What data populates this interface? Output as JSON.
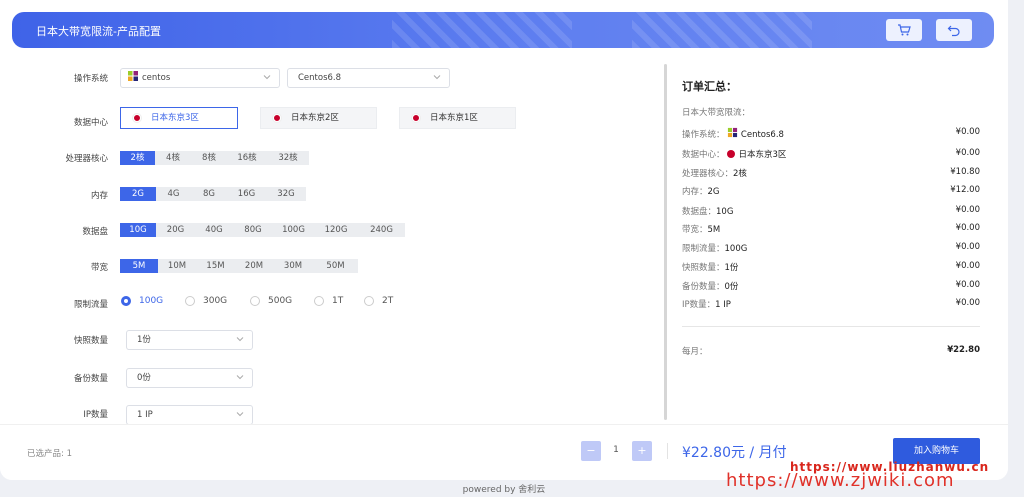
{
  "header": {
    "title": "日本大带宽限流-产品配置"
  },
  "config": {
    "os_label": "操作系统",
    "os_type": "centos",
    "os_version": "Centos6.8",
    "dc_label": "数据中心",
    "datacenters": [
      "日本东京3区",
      "日本东京2区",
      "日本东京1区"
    ],
    "cpu_label": "处理器核心",
    "cpu_options": [
      "2核",
      "4核",
      "8核",
      "16核",
      "32核"
    ],
    "mem_label": "内存",
    "mem_options": [
      "2G",
      "4G",
      "8G",
      "16G",
      "32G"
    ],
    "disk_label": "数据盘",
    "disk_options": [
      "10G",
      "20G",
      "40G",
      "80G",
      "100G",
      "120G",
      "240G"
    ],
    "bw_label": "带宽",
    "bw_options": [
      "5M",
      "10M",
      "15M",
      "20M",
      "30M",
      "50M"
    ],
    "traffic_label": "限制流量",
    "traffic_options": [
      "100G",
      "300G",
      "500G",
      "1T",
      "2T"
    ],
    "snapshot_label": "快照数量",
    "snapshot_value": "1份",
    "backup_label": "备份数量",
    "backup_value": "0份",
    "ip_label": "IP数量",
    "ip_value": "1 IP"
  },
  "summary": {
    "title": "订单汇总：",
    "product": "日本大带宽限流：",
    "rows": [
      {
        "label": "操作系统：",
        "value": "Centos6.8",
        "price": "¥0.00"
      },
      {
        "label": "数据中心：",
        "value": "日本东京3区",
        "price": "¥0.00"
      },
      {
        "label": "处理器核心：",
        "value": "2核",
        "price": "¥10.80"
      },
      {
        "label": "内存：",
        "value": "2G",
        "price": "¥12.00"
      },
      {
        "label": "数据盘：",
        "value": "10G",
        "price": "¥0.00"
      },
      {
        "label": "带宽：",
        "value": "5M",
        "price": "¥0.00"
      },
      {
        "label": "限制流量：",
        "value": "100G",
        "price": "¥0.00"
      },
      {
        "label": "快照数量：",
        "value": "1份",
        "price": "¥0.00"
      },
      {
        "label": "备份数量：",
        "value": "0份",
        "price": "¥0.00"
      },
      {
        "label": "IP数量：",
        "value": "1 IP",
        "price": "¥0.00"
      }
    ],
    "monthly_label": "每月：",
    "monthly_total": "¥22.80"
  },
  "footer": {
    "selected": "已选产品: 1",
    "minus": "−",
    "quantity": "1",
    "plus": "+",
    "price": "¥22.80元 / 月付",
    "add_to_cart": "加入购物车"
  },
  "powered_by": "powered by 舍利云",
  "watermarks": [
    "https://www.liuzhanwu.cn",
    "https://www.zjwiki.com"
  ],
  "colors": {
    "accent": "#3d66e8",
    "header_start": "#3f63e8",
    "header_end": "#6f8cf2"
  }
}
